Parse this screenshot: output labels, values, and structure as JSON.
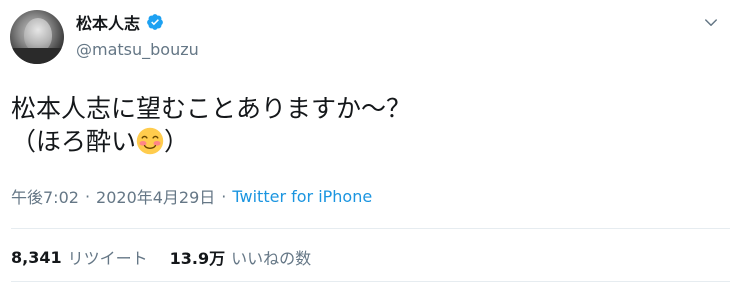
{
  "author": {
    "display_name": "松本人志",
    "handle": "@matsu_bouzu",
    "verified": true,
    "verified_color": "#1da1f2"
  },
  "tweet": {
    "line1": "松本人志に望むことありますか〜？",
    "line2_before_emoji": "（ほろ酔い",
    "emoji": "blushing-smile-emoji",
    "line2_after_emoji": "）"
  },
  "meta": {
    "time": "午後7:02",
    "separator": "·",
    "date": "2020年4月29日",
    "source": "Twitter for iPhone",
    "link_color": "#1b95e0"
  },
  "stats": {
    "retweets_count": "8,341",
    "retweets_label": "リツイート",
    "likes_count": "13.9万",
    "likes_label": "いいねの数"
  },
  "icons": {
    "verified": "verified-badge-icon",
    "menu": "chevron-down-icon"
  }
}
